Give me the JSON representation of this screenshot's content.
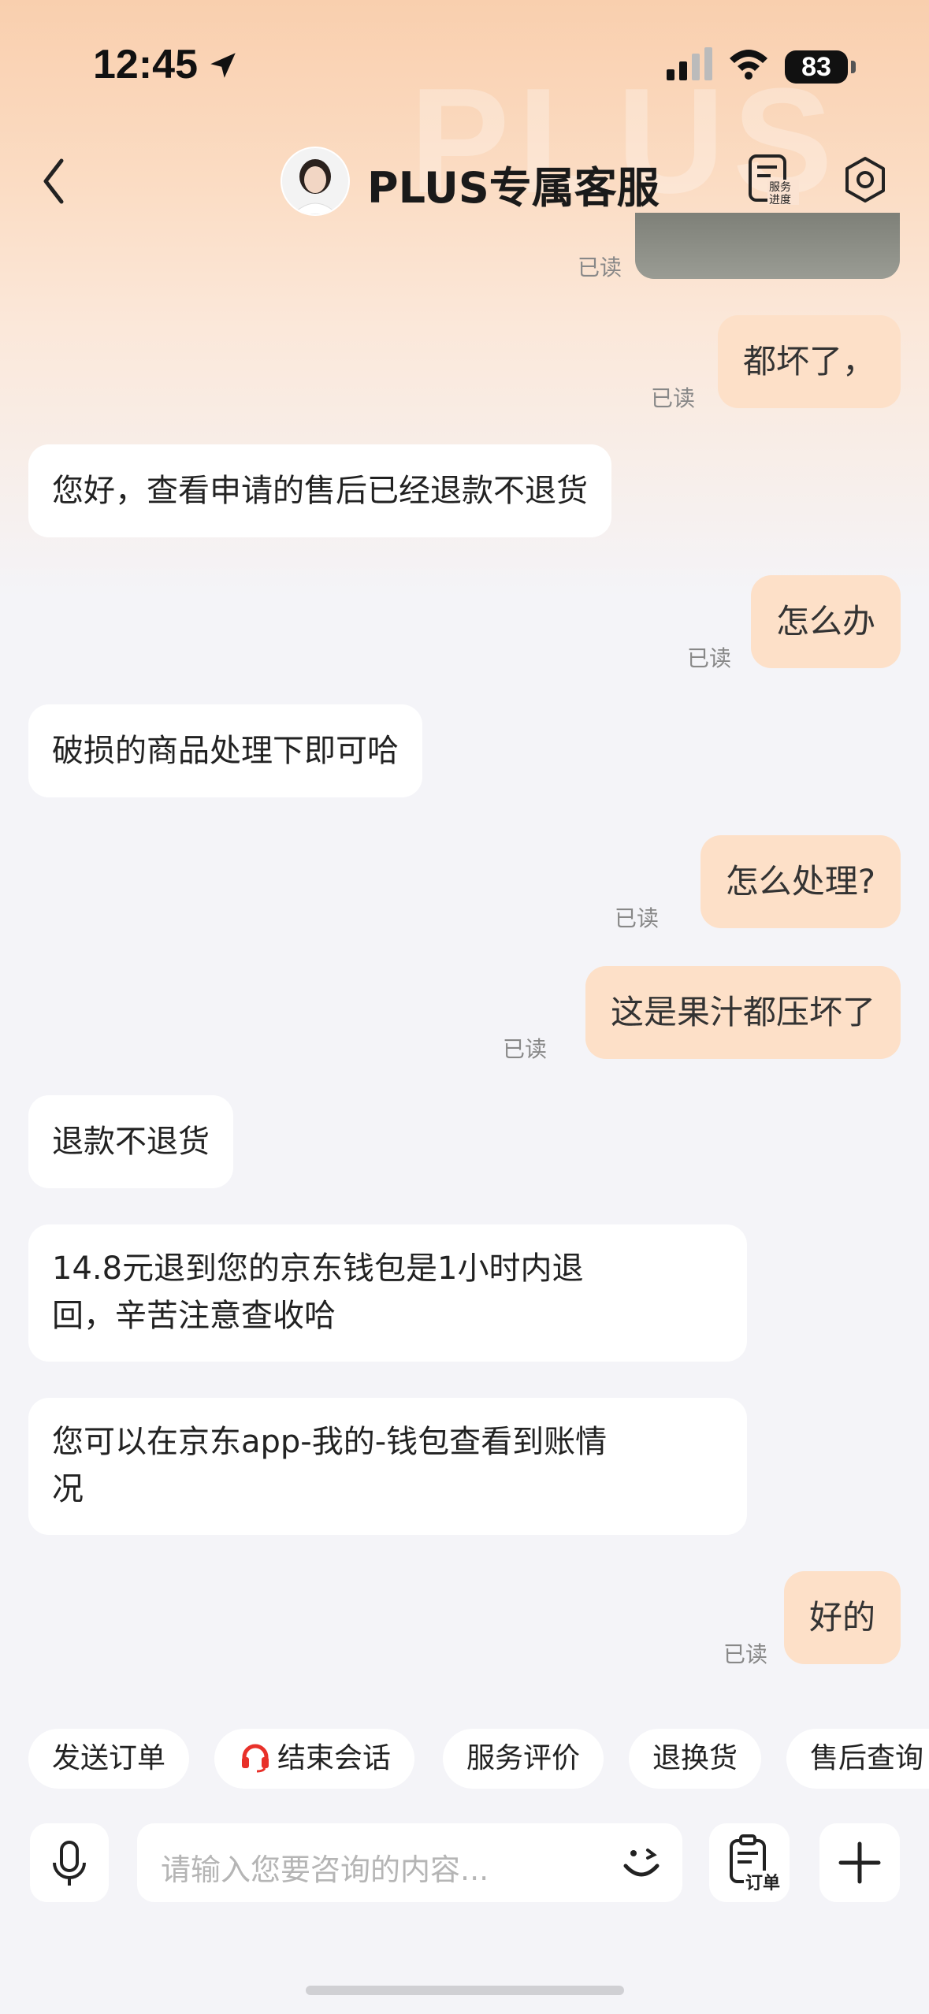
{
  "status_bar": {
    "time": "12:45",
    "battery": "83"
  },
  "header": {
    "title": "PLUS专属客服",
    "service_progress_label": "服务\n进度"
  },
  "messages": [
    {
      "side": "right",
      "text": "都坏了，",
      "status": "已读"
    },
    {
      "side": "left",
      "text": "您好，查看申请的售后已经退款不退货"
    },
    {
      "side": "right",
      "text": "怎么办",
      "status": "已读"
    },
    {
      "side": "left",
      "text": "破损的商品处理下即可哈"
    },
    {
      "side": "right",
      "text": "怎么处理?",
      "status": "已读"
    },
    {
      "side": "right",
      "text": "这是果汁都压坏了",
      "status": "已读"
    },
    {
      "side": "left",
      "text": "退款不退货"
    },
    {
      "side": "left",
      "text": "14.8元退到您的京东钱包是1小时内退\n回，辛苦注意查收哈"
    },
    {
      "side": "left",
      "text": "您可以在京东app-我的-钱包查看到账情\n况"
    },
    {
      "side": "right",
      "text": "好的",
      "status": "已读"
    }
  ],
  "image_message_status": "已读",
  "quick_actions": [
    "发送订单",
    "结束会话",
    "服务评价",
    "退换货",
    "售后查询"
  ],
  "input": {
    "placeholder": "请输入您要咨询的内容...",
    "order_label": "订单"
  },
  "colors": {
    "accent_bubble": "#fde0c8",
    "header_gradient": "#f9cfae",
    "end_chat_icon": "#e8312a"
  }
}
